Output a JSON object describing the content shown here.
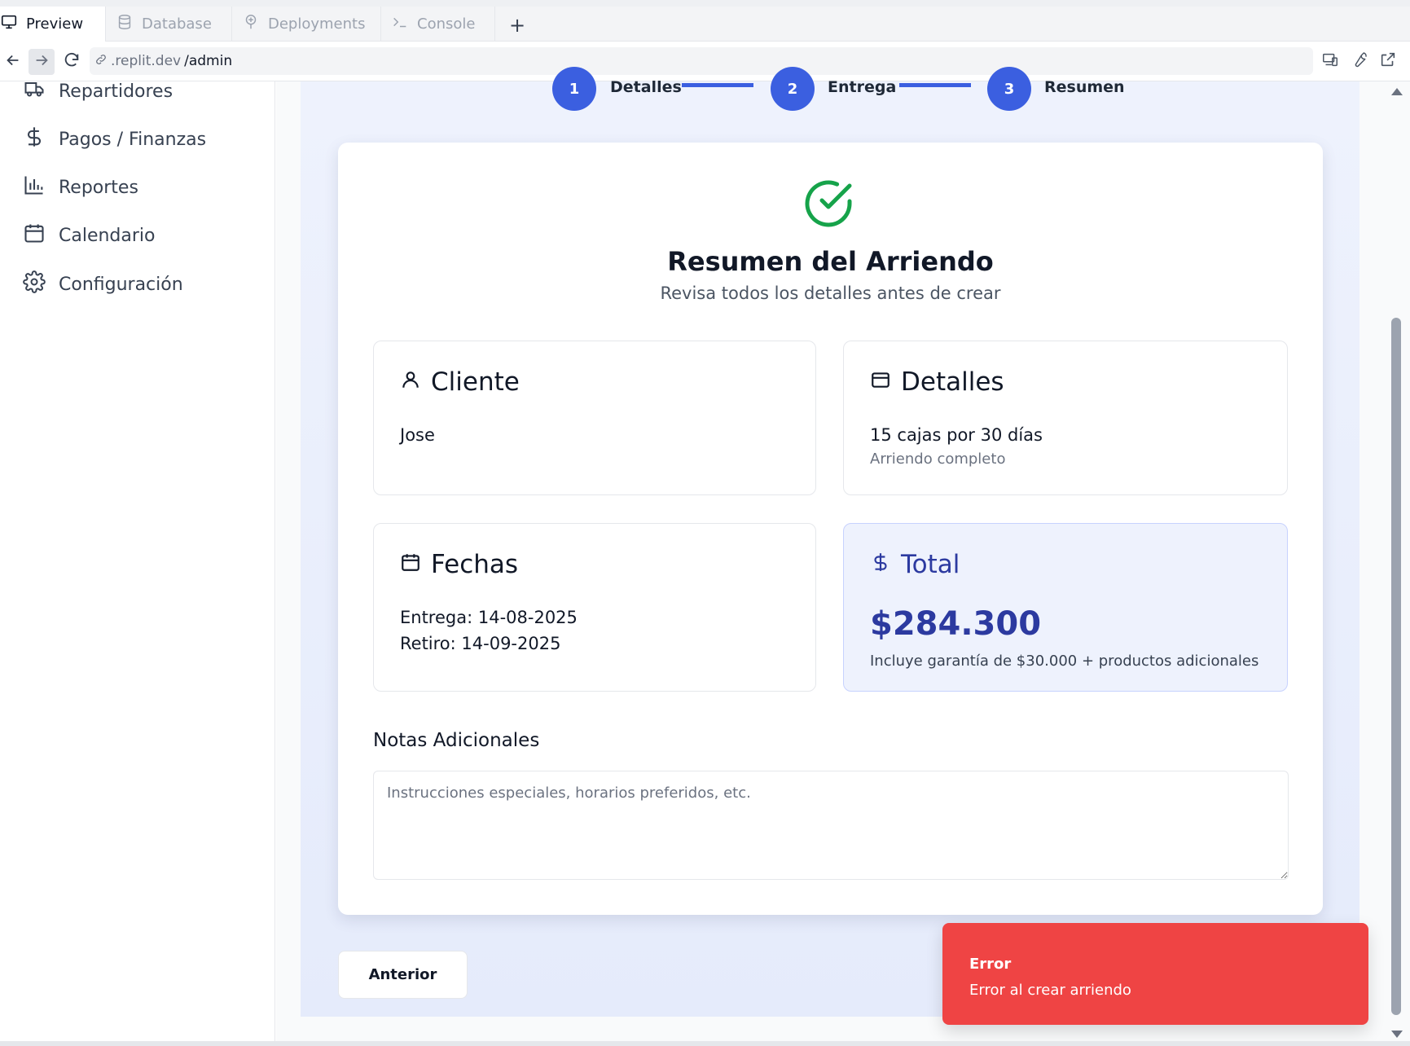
{
  "tabs": [
    {
      "label": "Preview",
      "icon": "monitor-icon",
      "active": true
    },
    {
      "label": "Database",
      "icon": "database-icon",
      "active": false
    },
    {
      "label": "Deployments",
      "icon": "deployments-icon",
      "active": false
    },
    {
      "label": "Console",
      "icon": "terminal-icon",
      "active": false
    }
  ],
  "tab_add_label": "+",
  "address": {
    "domain": ".replit.dev",
    "path": "/admin"
  },
  "sidebar": {
    "items": [
      {
        "label": "Repartidores",
        "icon": "truck-icon"
      },
      {
        "label": "Pagos / Finanzas",
        "icon": "dollar-icon"
      },
      {
        "label": "Reportes",
        "icon": "bar-chart-icon"
      },
      {
        "label": "Calendario",
        "icon": "calendar-icon"
      },
      {
        "label": "Configuración",
        "icon": "gear-icon"
      }
    ]
  },
  "stepper": {
    "steps": [
      {
        "number": "1",
        "label": "Detalles"
      },
      {
        "number": "2",
        "label": "Entrega"
      },
      {
        "number": "3",
        "label": "Resumen"
      }
    ]
  },
  "summary": {
    "title": "Resumen del Arriendo",
    "subtitle": "Revisa todos los detalles antes de crear",
    "client": {
      "heading": "Cliente",
      "name": "Jose"
    },
    "details": {
      "heading": "Detalles",
      "line": "15 cajas por 30 días",
      "note": "Arriendo completo"
    },
    "dates": {
      "heading": "Fechas",
      "delivery": "Entrega: 14-08-2025",
      "pickup": "Retiro: 14-09-2025"
    },
    "total": {
      "heading": "Total",
      "amount": "$284.300",
      "note": "Incluye garantía de $30.000 + productos adicionales"
    }
  },
  "notes": {
    "label": "Notas Adicionales",
    "value": "",
    "placeholder": "Instrucciones especiales, horarios preferidos, etc."
  },
  "buttons": {
    "previous": "Anterior"
  },
  "toast": {
    "title": "Error",
    "message": "Error al crear arriendo"
  },
  "colors": {
    "accent": "#3b5fe0",
    "success": "#16a34a",
    "error": "#ef4444",
    "total_text": "#2c3aa0"
  }
}
